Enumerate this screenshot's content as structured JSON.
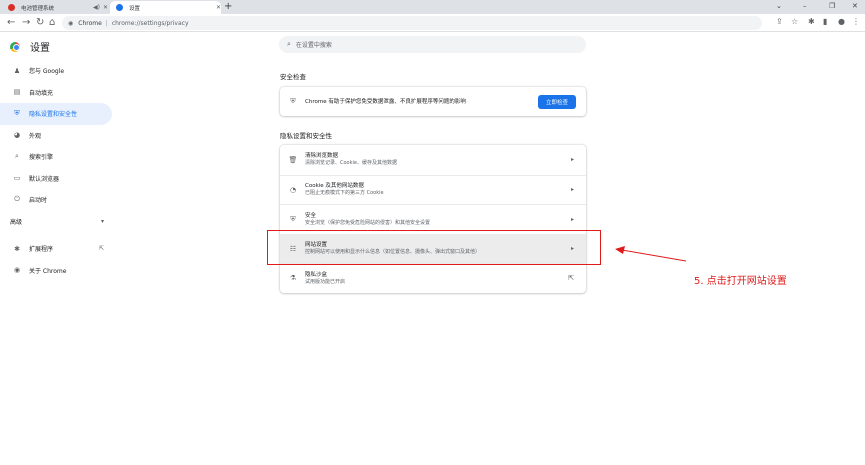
{
  "tabs": [
    {
      "title": "电池管理系统",
      "active": false
    },
    {
      "title": "设置",
      "active": true
    }
  ],
  "toolbar": {
    "omnibox_label": "Chrome",
    "url": "chrome://settings/privacy"
  },
  "sidebar": {
    "title": "设置",
    "items": [
      {
        "label": "您与 Google",
        "icon": "person-icon"
      },
      {
        "label": "自动填充",
        "icon": "clipboard-icon"
      },
      {
        "label": "隐私设置和安全性",
        "icon": "shield-icon",
        "active": true
      },
      {
        "label": "外观",
        "icon": "palette-icon"
      },
      {
        "label": "搜索引擎",
        "icon": "search-icon"
      },
      {
        "label": "默认浏览器",
        "icon": "browser-icon"
      },
      {
        "label": "启动时",
        "icon": "power-icon"
      },
      {
        "label": "高级",
        "icon": "chevron-down-icon"
      },
      {
        "label": "扩展程序",
        "icon": "puzzle-icon"
      },
      {
        "label": "关于 Chrome",
        "icon": "chrome-icon"
      }
    ]
  },
  "search": {
    "placeholder": "在设置中搜索"
  },
  "safety_check": {
    "section_title": "安全检查",
    "text": "Chrome 有助于保护您免受数据泄露、不良扩展程序等问题的影响",
    "button_label": "立即检查"
  },
  "privacy": {
    "section_title": "隐私设置和安全性",
    "rows": [
      {
        "title": "清除浏览数据",
        "subtitle": "清除浏览记录、Cookie、缓存及其他数据",
        "icon": "trash-icon"
      },
      {
        "title": "Cookie 及其他网站数据",
        "subtitle": "已阻止无痕模式下的第三方 Cookie",
        "icon": "cookie-icon"
      },
      {
        "title": "安全",
        "subtitle": "安全浏览（保护您免受危险网站的侵害）和其他安全设置",
        "icon": "shield-icon"
      },
      {
        "title": "网站设置",
        "subtitle": "控制网站可以使用和显示什么信息（如位置信息、摄像头、弹出式窗口及其他）",
        "icon": "sliders-icon"
      },
      {
        "title": "隐私沙盒",
        "subtitle": "试用版功能已开启",
        "icon": "flask-icon"
      }
    ]
  },
  "annotation": {
    "text": "5. 点击打开网站设置",
    "color": "#e01a1a"
  }
}
